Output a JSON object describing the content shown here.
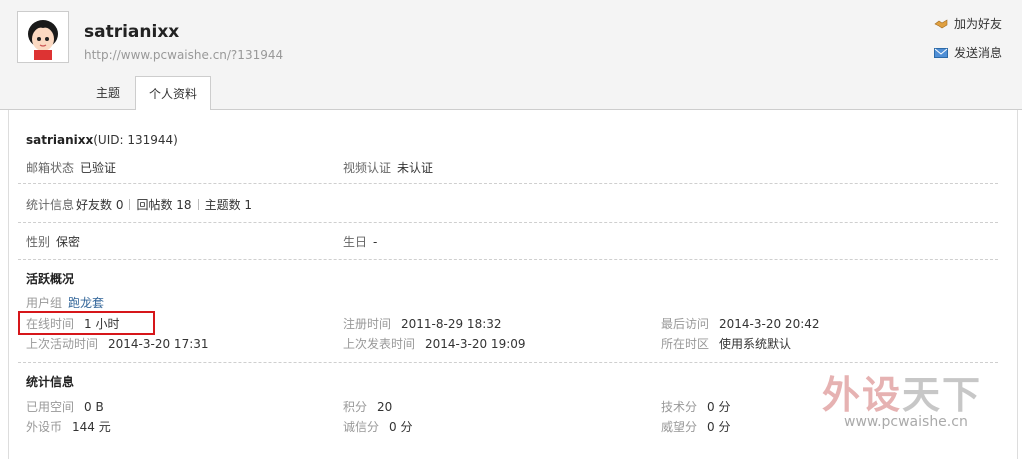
{
  "header": {
    "username": "satrianixx",
    "url": "http://www.pcwaishe.cn/?131944",
    "actions": {
      "add_friend": "加为好友",
      "send_message": "发送消息"
    },
    "tabs": [
      "主题",
      "个人资料"
    ]
  },
  "profile": {
    "name": "satrianixx",
    "uid": "(UID: 131944)",
    "email_status": {
      "label": "邮箱状态",
      "value": "已验证"
    },
    "video_auth": {
      "label": "视频认证",
      "value": "未认证"
    },
    "stats": {
      "label": "统计信息",
      "friends": "好友数 0",
      "replies": "回帖数 18",
      "topics": "主题数 1"
    },
    "gender": {
      "label": "性别",
      "value": "保密"
    },
    "birthday": {
      "label": "生日",
      "value": "-"
    }
  },
  "activity": {
    "title": "活跃概况",
    "user_group": {
      "label": "用户组",
      "value": "跑龙套"
    },
    "online_time": {
      "label": "在线时间",
      "value": "1 小时"
    },
    "register_time": {
      "label": "注册时间",
      "value": "2011-8-29 18:32"
    },
    "last_visit": {
      "label": "最后访问",
      "value": "2014-3-20 20:42"
    },
    "last_activity": {
      "label": "上次活动时间",
      "value": "2014-3-20 17:31"
    },
    "last_post": {
      "label": "上次发表时间",
      "value": "2014-3-20 19:09"
    },
    "timezone": {
      "label": "所在时区",
      "value": "使用系统默认"
    }
  },
  "statistics": {
    "title": "统计信息",
    "space_used": {
      "label": "已用空间",
      "value": "0 B"
    },
    "points": {
      "label": "积分",
      "value": "20"
    },
    "tech_points": {
      "label": "技术分",
      "value": "0 分"
    },
    "coins": {
      "label": "外设币",
      "value": "144 元"
    },
    "integrity": {
      "label": "诚信分",
      "value": "0 分"
    },
    "prestige": {
      "label": "威望分",
      "value": "0 分"
    }
  },
  "watermark": {
    "title_a": "外设",
    "title_b": "天下",
    "url": "www.pcwaishe.cn"
  },
  "colors": {
    "highlight": "#d6161a",
    "link": "#336699"
  }
}
